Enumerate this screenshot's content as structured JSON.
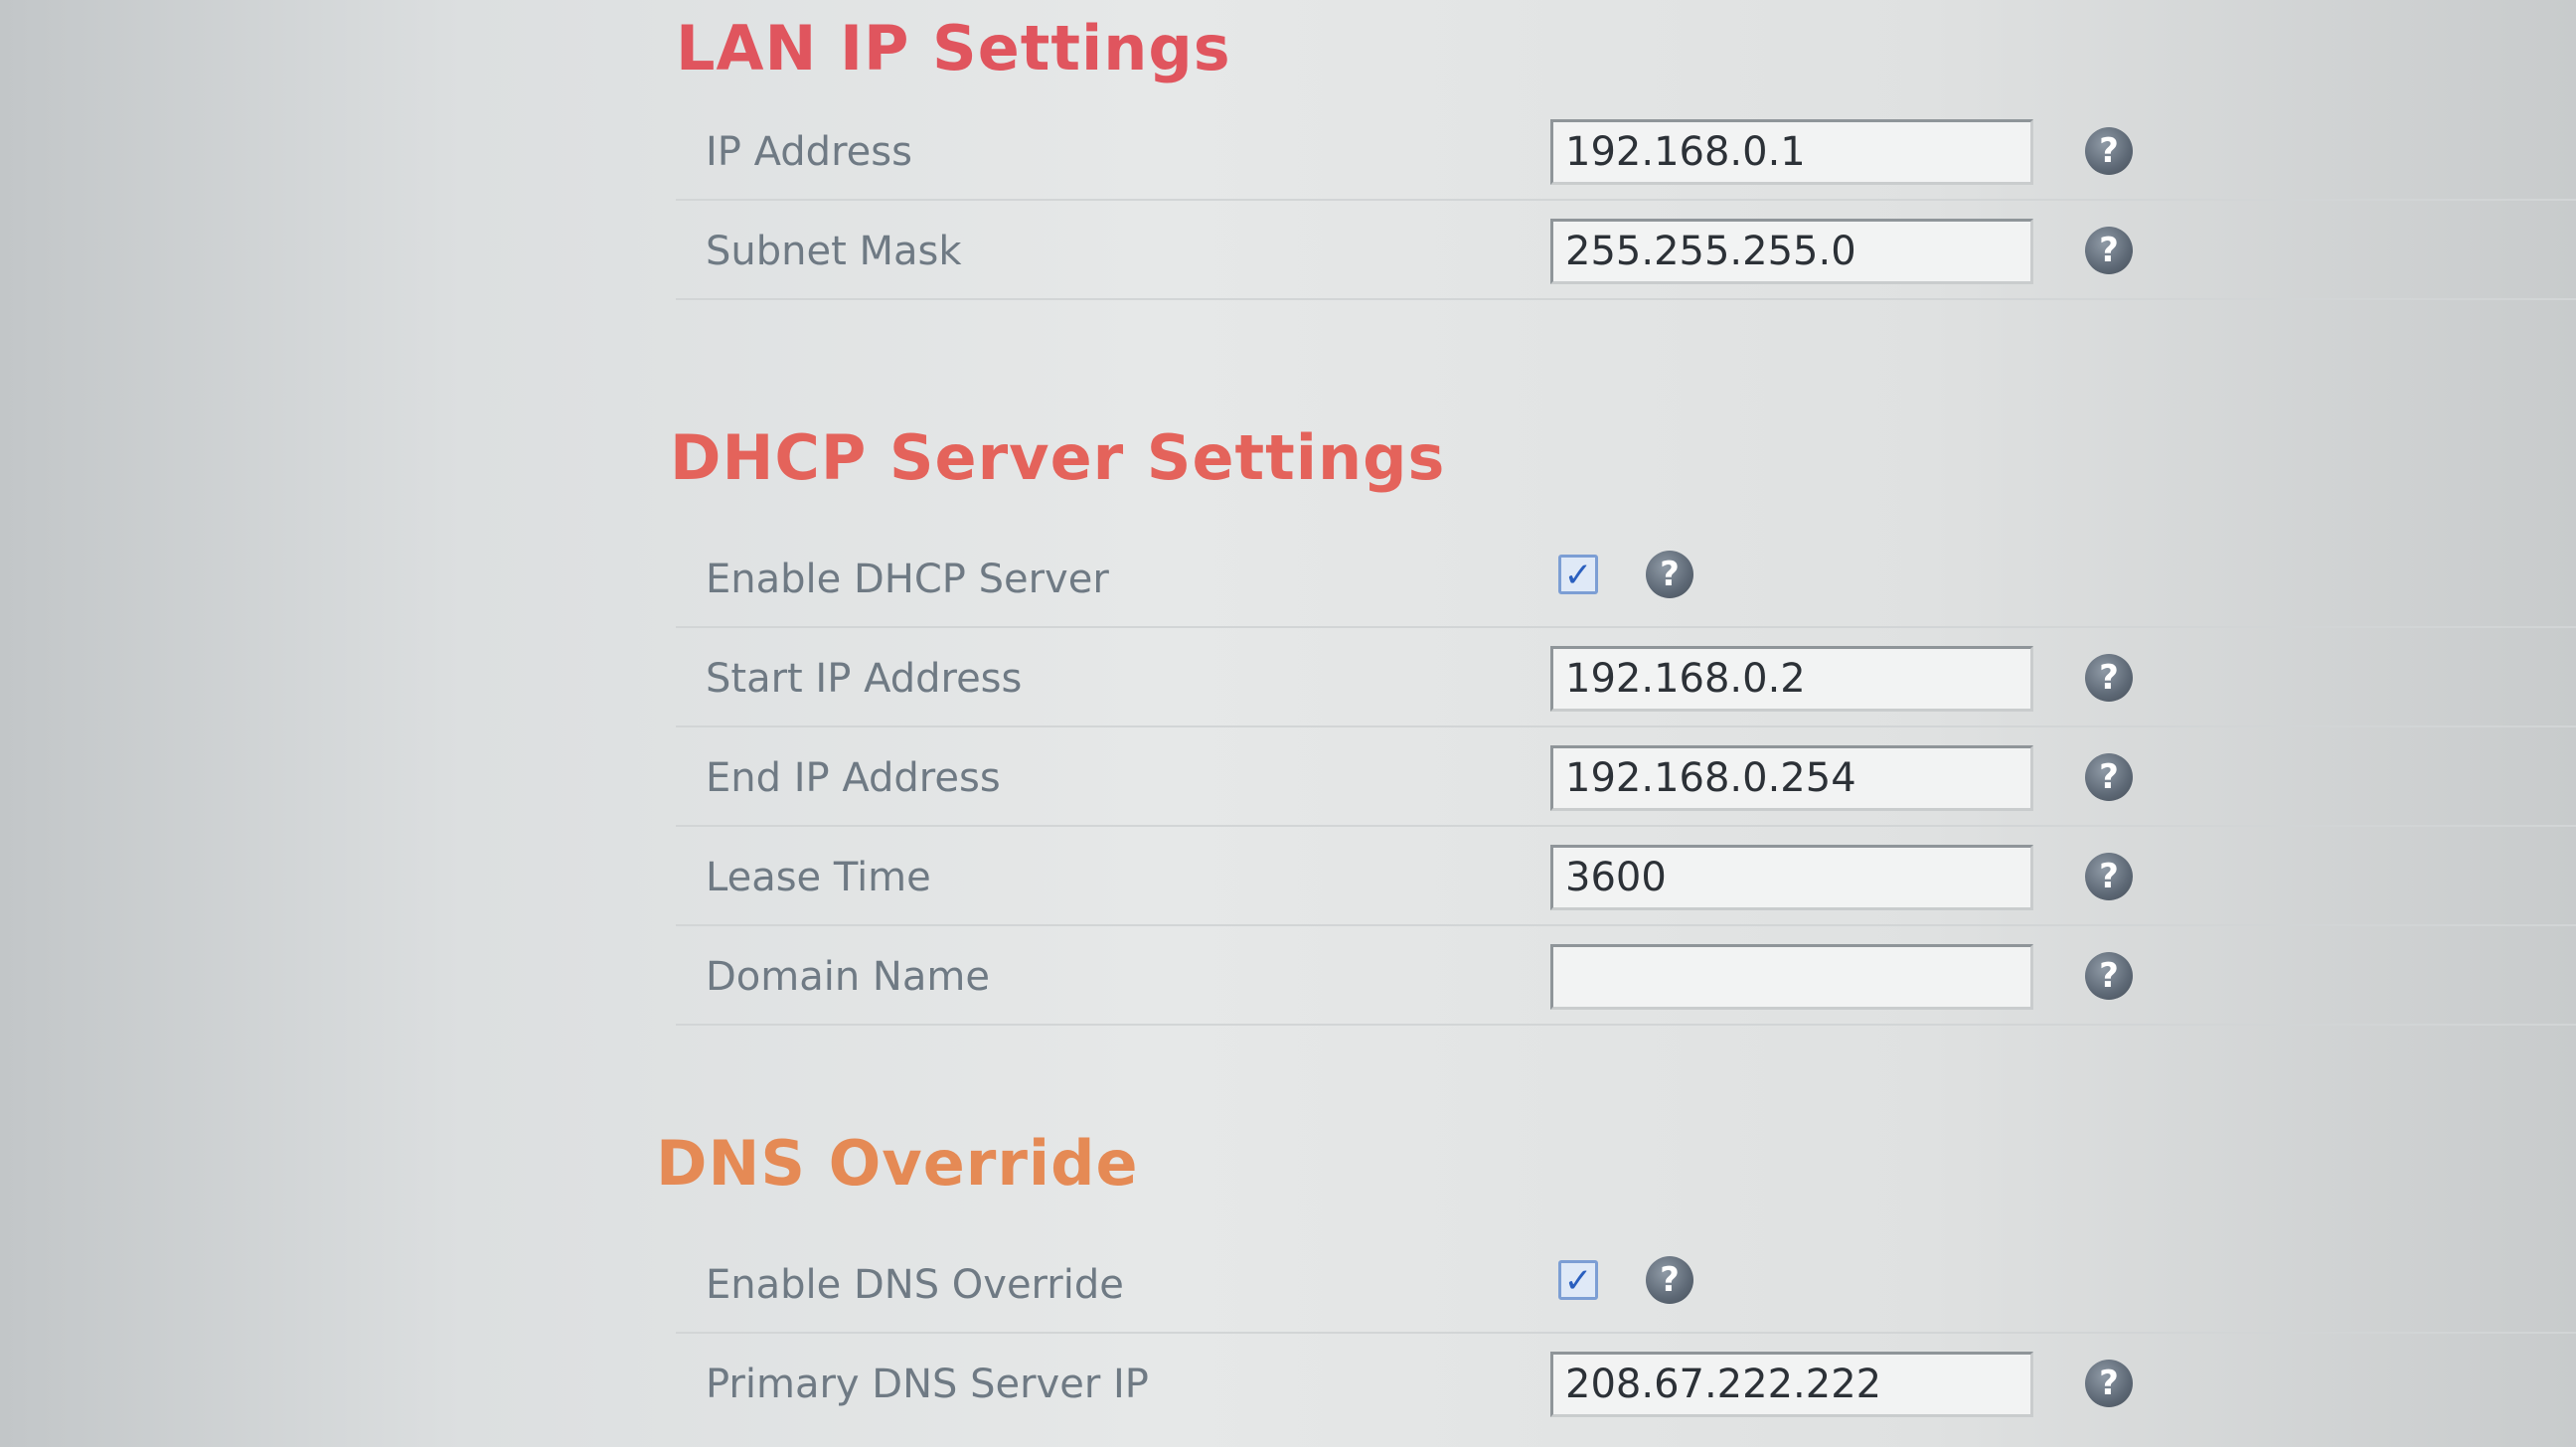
{
  "lan": {
    "title": "LAN IP Settings",
    "ip_address": {
      "label": "IP Address",
      "value": "192.168.0.1"
    },
    "subnet_mask": {
      "label": "Subnet Mask",
      "value": "255.255.255.0"
    }
  },
  "dhcp": {
    "title": "DHCP Server Settings",
    "enable": {
      "label": "Enable DHCP Server",
      "checked_glyph": "✓"
    },
    "start_ip": {
      "label": "Start IP Address",
      "value": "192.168.0.2"
    },
    "end_ip": {
      "label": "End IP Address",
      "value": "192.168.0.254"
    },
    "lease_time": {
      "label": "Lease Time",
      "value": "3600"
    },
    "domain_name": {
      "label": "Domain Name",
      "value": ""
    }
  },
  "dns": {
    "title": "DNS Override",
    "enable": {
      "label": "Enable DNS Override",
      "checked_glyph": "✓"
    },
    "primary_dns": {
      "label": "Primary DNS Server IP",
      "value": "208.67.222.222"
    }
  },
  "help_glyph": "?",
  "icons": {
    "help": "help-icon",
    "checkbox_checked": "checkbox-checked"
  },
  "colors": {
    "lan_title": "#e0555e",
    "dhcp_title": "#e4635b",
    "dns_title": "#e58a55",
    "label_text": "#6f7a84",
    "help_icon": "#5d6875",
    "checkbox_check": "#2a5fbf"
  }
}
